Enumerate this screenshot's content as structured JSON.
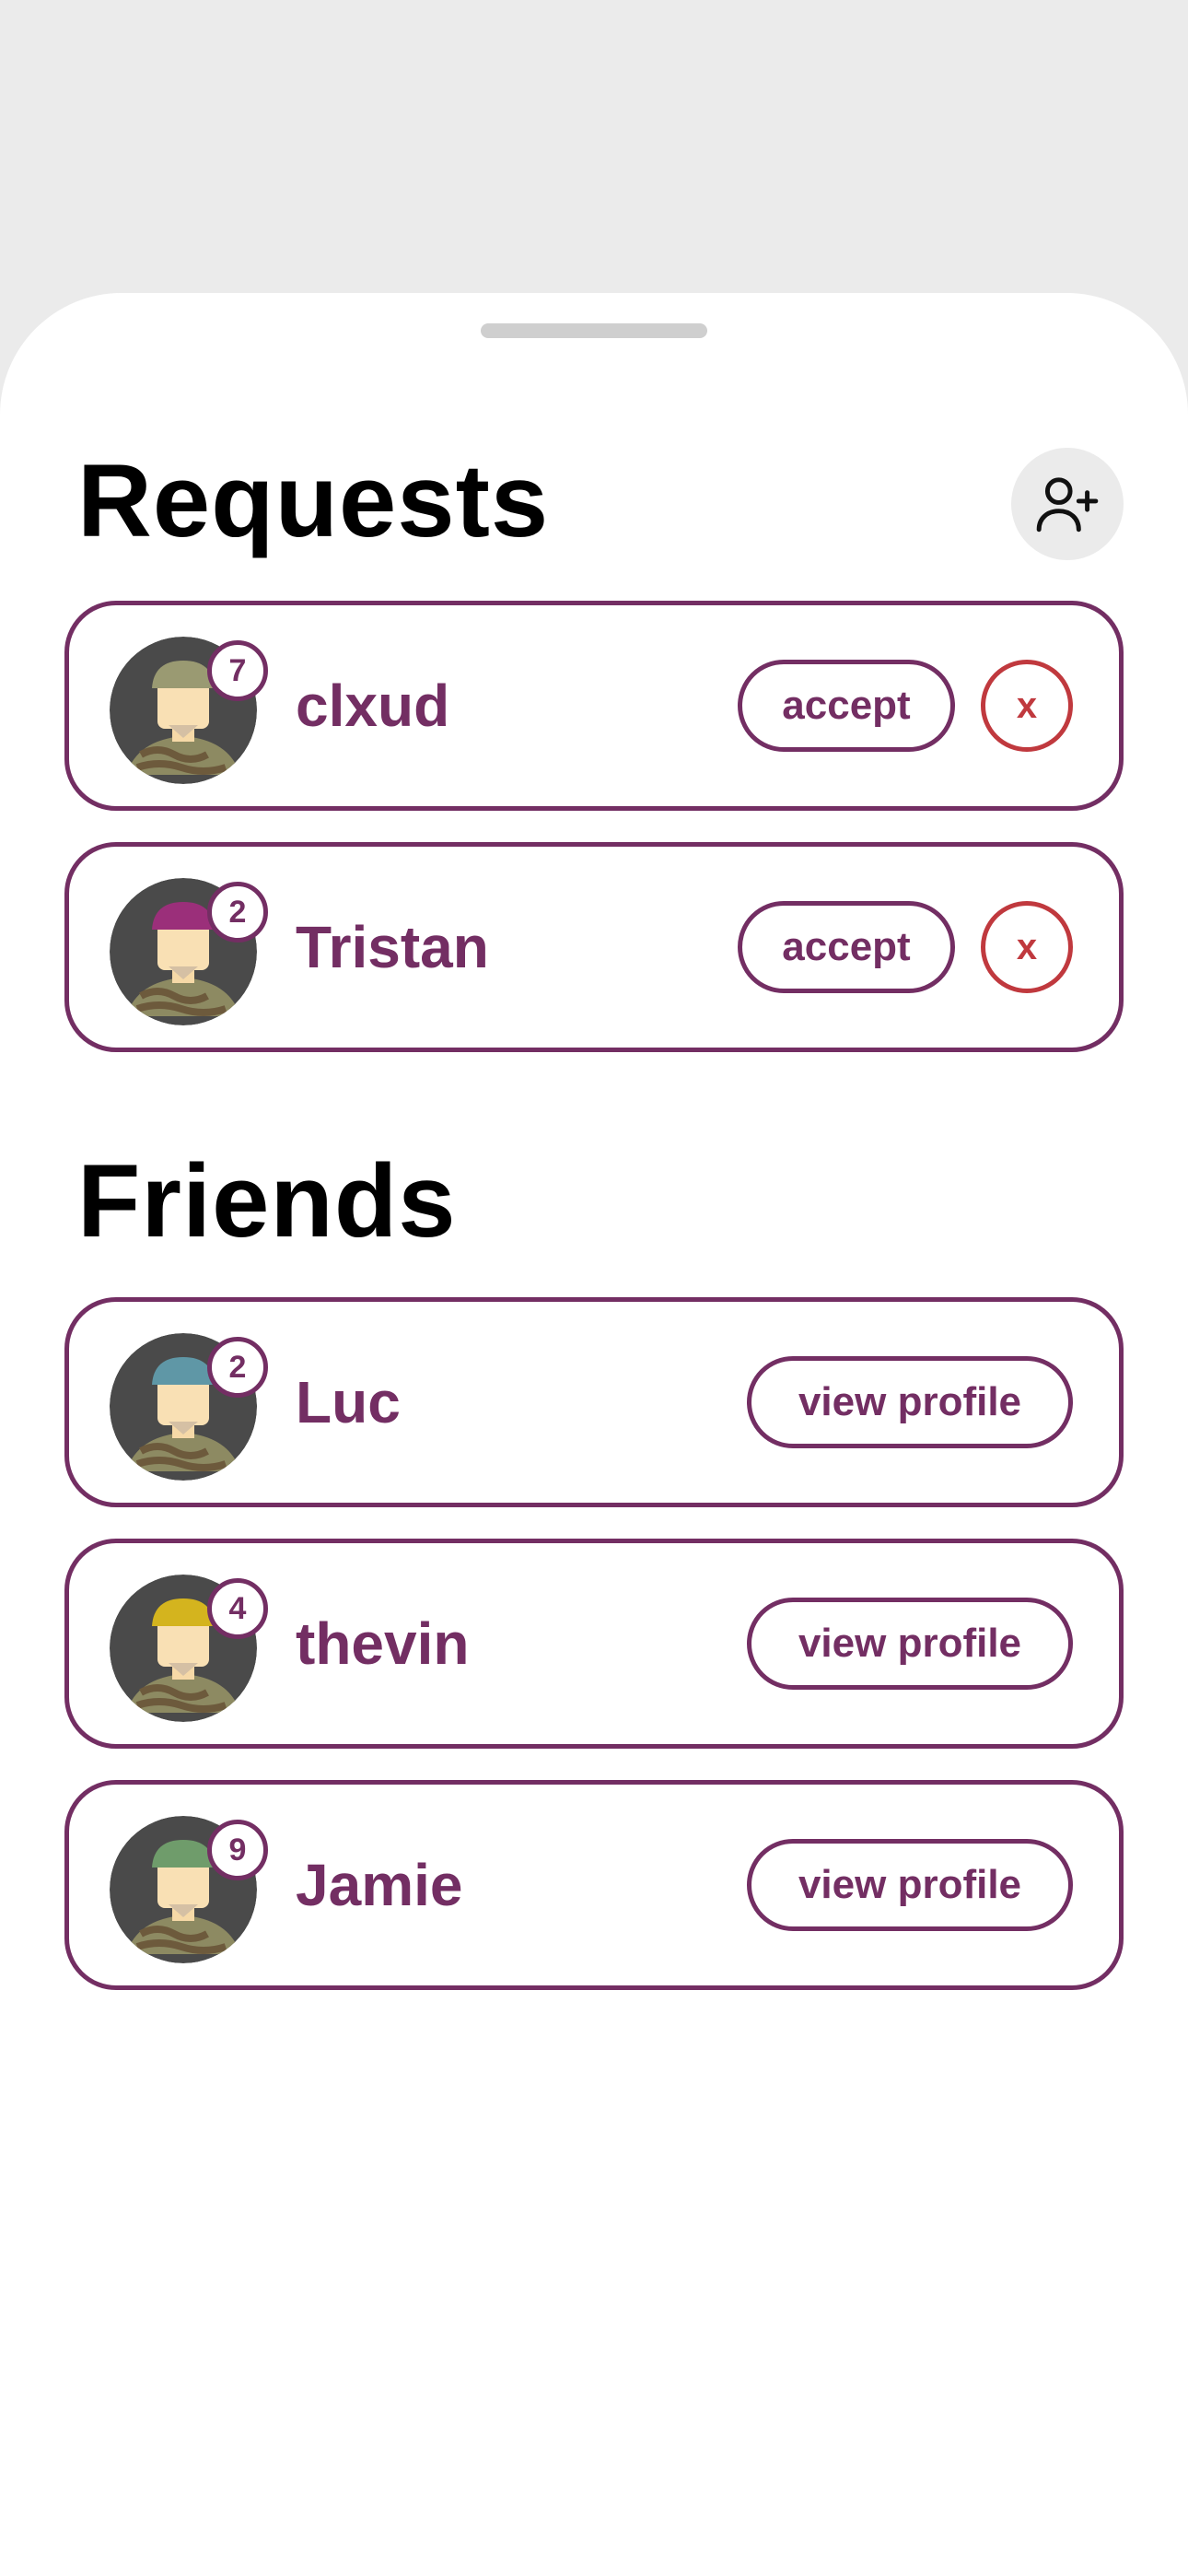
{
  "colors": {
    "background": "#ebebeb",
    "accent": "#732e63",
    "decline": "#c0393e",
    "sheet": "#ffffff"
  },
  "requests": {
    "title": "Requests",
    "add_friend_icon": "add-user-icon",
    "items": [
      {
        "name": "clxud",
        "level": "7",
        "hat_color": "#9a9a72",
        "accept_label": "accept",
        "decline_label": "x"
      },
      {
        "name": "Tristan",
        "level": "2",
        "hat_color": "#9b2f7a",
        "accept_label": "accept",
        "decline_label": "x"
      }
    ]
  },
  "friends": {
    "title": "Friends",
    "items": [
      {
        "name": "Luc",
        "level": "2",
        "hat_color": "#5f97a6",
        "action_label": "view profile"
      },
      {
        "name": "thevin",
        "level": "4",
        "hat_color": "#d4b41e",
        "action_label": "view profile"
      },
      {
        "name": "Jamie",
        "level": "9",
        "hat_color": "#6f9c6b",
        "action_label": "view profile"
      }
    ]
  }
}
